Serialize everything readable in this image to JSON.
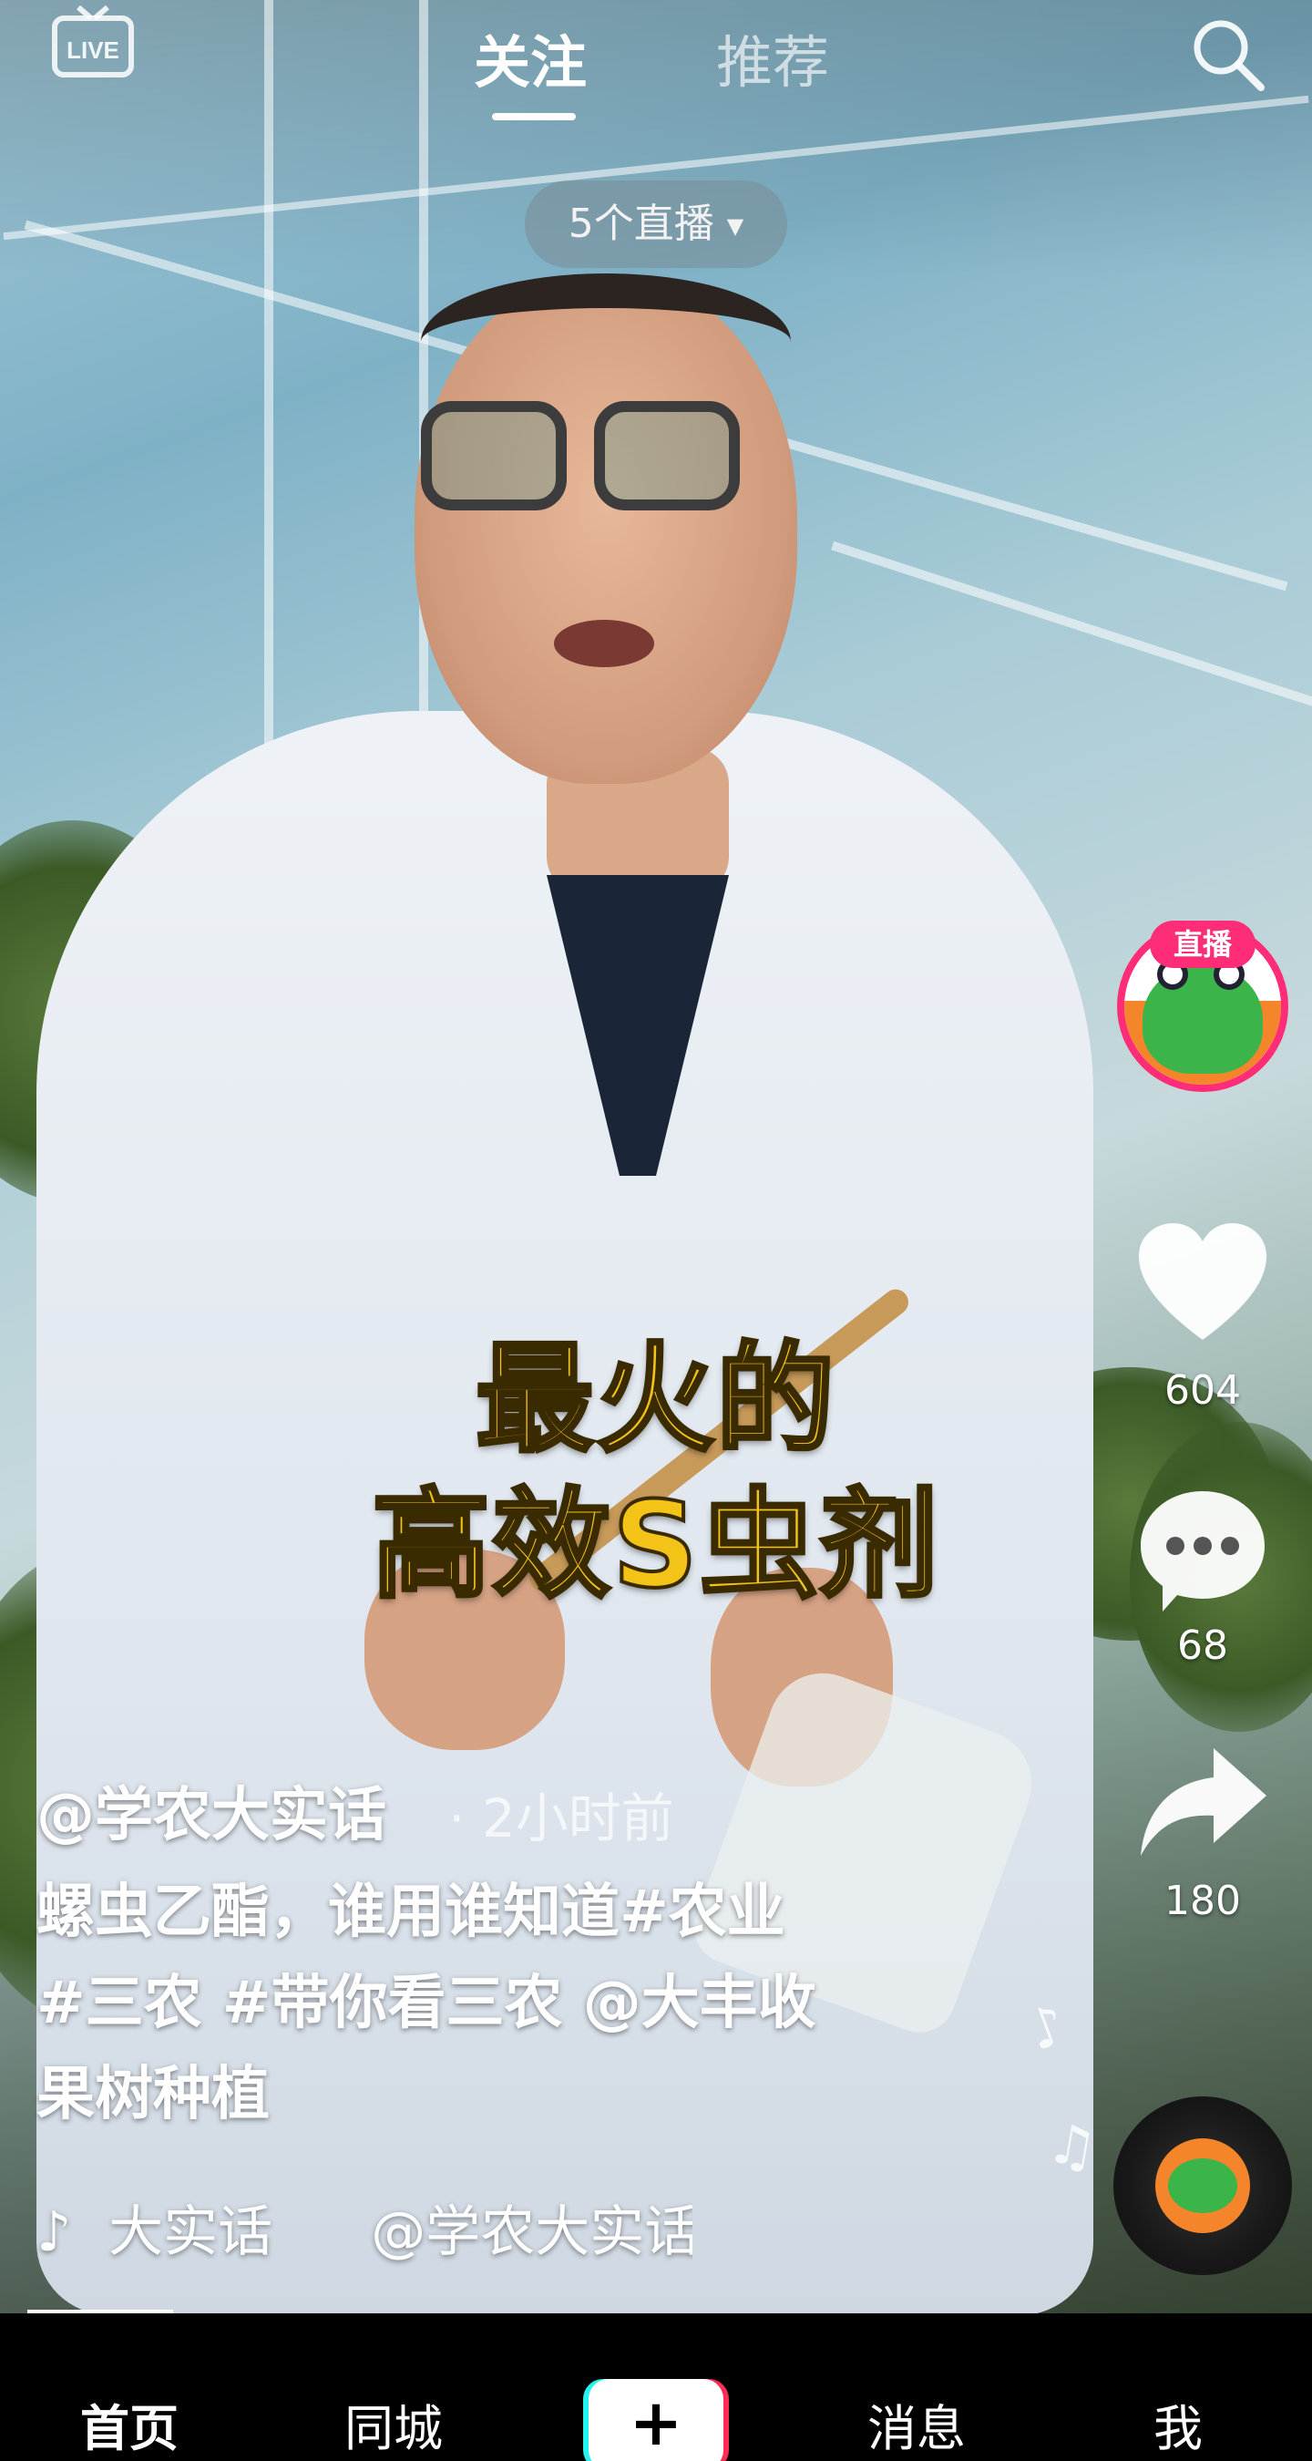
{
  "top_bar": {
    "live_label": "LIVE",
    "tabs": [
      {
        "label": "关注",
        "active": true
      },
      {
        "label": "推荐",
        "active": false
      }
    ]
  },
  "live_pill": {
    "label": "5个直播"
  },
  "video_caption": {
    "line1": "最火的",
    "line2": "高效S虫剂"
  },
  "right_rail": {
    "live_badge": "直播",
    "likes": "604",
    "comments": "68",
    "shares": "180"
  },
  "post": {
    "author": "@学农大实话",
    "time": "· 2小时前",
    "description_lines": [
      "螺虫乙酯，谁用谁知道#农业",
      "#三农 #带你看三农 @大丰收",
      "果树种植"
    ],
    "music_note": "♪",
    "music_title": "大实话",
    "music_author": "@学农大实话"
  },
  "bottom_nav": {
    "items": [
      {
        "label": "首页",
        "active": true
      },
      {
        "label": "同城",
        "active": false
      },
      {
        "label": "消息",
        "active": false
      },
      {
        "label": "我",
        "active": false
      }
    ],
    "add_label": "+"
  },
  "colors": {
    "caption": "#f3c318",
    "live_pink": "#ff2d78",
    "add_cyan": "#25f4ee",
    "add_red": "#fe2c55"
  }
}
